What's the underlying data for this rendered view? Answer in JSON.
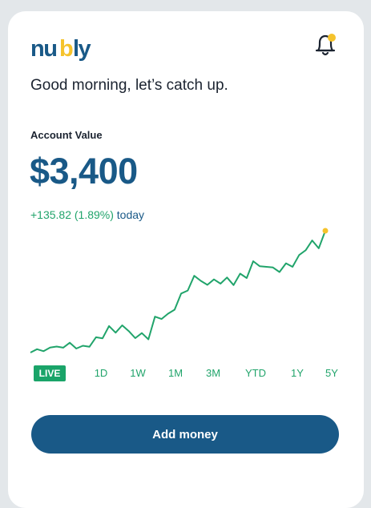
{
  "app": {
    "brand": "nubly",
    "brand_color": "#195987",
    "accent_color": "#21a46b"
  },
  "header": {
    "notification_icon": "bell-icon",
    "notification_dot_color": "#f5c32c"
  },
  "greeting": "Good morning, let’s catch up.",
  "account": {
    "label": "Account Value",
    "value": "$3,400",
    "change": "+135.82 (1.89%)",
    "change_period": "today"
  },
  "chart_data": {
    "type": "line",
    "title": "",
    "xlabel": "",
    "ylabel": "",
    "grid": false,
    "values": [
      3264.2,
      3266.5,
      3265.1,
      3267.6,
      3268.3,
      3267.5,
      3270.9,
      3266.9,
      3268.8,
      3268.1,
      3274.6,
      3273.9,
      3282.2,
      3277.7,
      3282.7,
      3278.8,
      3274.0,
      3277.4,
      3273.2,
      3288.6,
      3287.0,
      3290.6,
      3293.3,
      3304.3,
      3306.3,
      3316.3,
      3312.9,
      3310.2,
      3313.9,
      3311.0,
      3315.2,
      3310.0,
      3317.8,
      3314.8,
      3326.2,
      3322.8,
      3322.4,
      3322.0,
      3318.9,
      3324.8,
      3322.4,
      3330.4,
      3333.7,
      3340.3,
      3335.0,
      3346.9
    ]
  },
  "ranges": [
    {
      "label": "LIVE",
      "active": true
    },
    {
      "label": "1D",
      "active": false
    },
    {
      "label": "1W",
      "active": false
    },
    {
      "label": "1M",
      "active": false
    },
    {
      "label": "3M",
      "active": false
    },
    {
      "label": "YTD",
      "active": false
    },
    {
      "label": "1Y",
      "active": false
    },
    {
      "label": "5Y",
      "active": false
    }
  ],
  "cta": {
    "add_money": "Add money"
  }
}
